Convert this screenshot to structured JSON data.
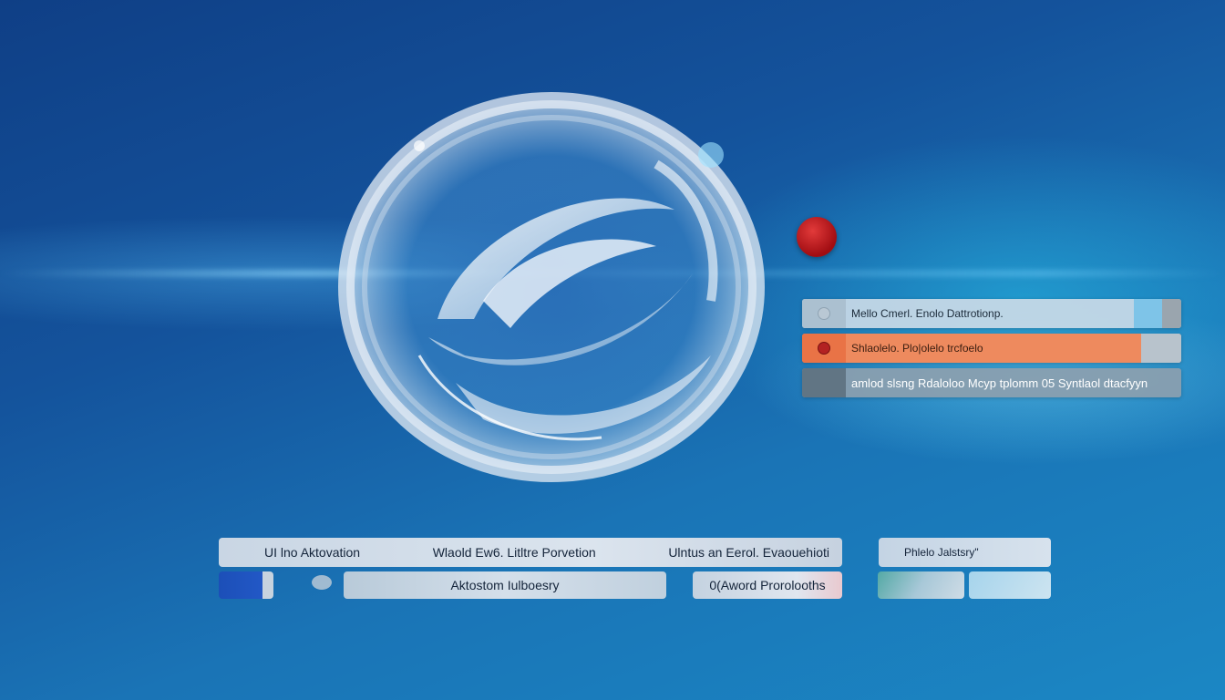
{
  "colors": {
    "background_dark": "#0f3f86",
    "background_light": "#1b87c4",
    "accent_orange": "#ee8a5e",
    "accent_red": "#b32222",
    "accent_blue": "#1c4fb8"
  },
  "hero": {
    "icon": "glass-swirl-sphere-icon",
    "badge_icon": "red-dot-icon"
  },
  "menu": {
    "items": [
      {
        "label": "Mello Cmerl. Enolo Dattrotionp.",
        "icon": "circle-icon",
        "state": "default"
      },
      {
        "label": "Shlaolelo. Plo|olelo trcfoelo",
        "icon": "red-circle-icon",
        "state": "selected"
      },
      {
        "label": "amlod slsng Rdaloloo Mcyp tplomm 05 Syntlaol dtacfyyn",
        "icon": "none",
        "state": "default"
      }
    ]
  },
  "toolbar": {
    "segments": [
      "UI lno Aktovation",
      "Wlaold Ew6. Litltre Porvetion",
      "Ulntus an Eerol. Evaouehioti"
    ],
    "phish_label": "Phlelo Jalstsry\"",
    "automation_label": "Aktostom Iulboesry",
    "protocols_label": "0(Aword Prorolooths"
  }
}
